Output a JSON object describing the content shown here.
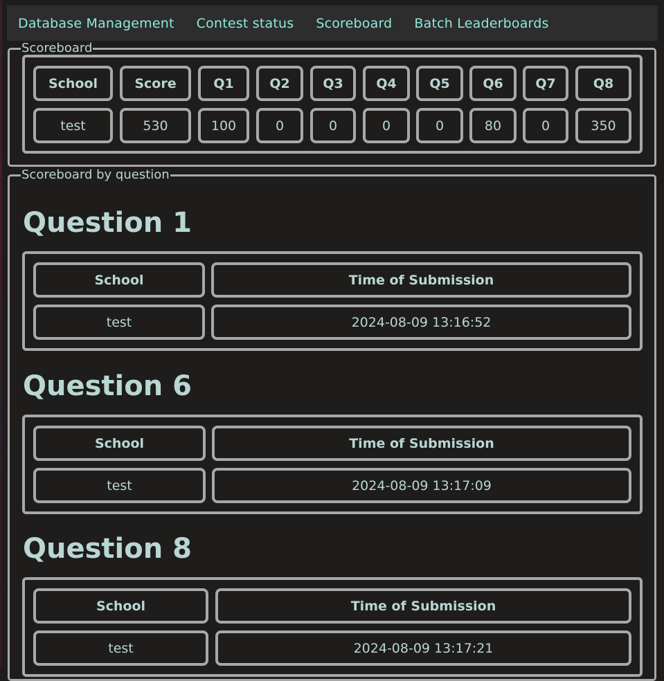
{
  "nav": {
    "items": [
      "Database Management",
      "Contest status",
      "Scoreboard",
      "Batch Leaderboards"
    ]
  },
  "scoreboard": {
    "legend": "Scoreboard",
    "headers": [
      "School",
      "Score",
      "Q1",
      "Q2",
      "Q3",
      "Q4",
      "Q5",
      "Q6",
      "Q7",
      "Q8"
    ],
    "row": [
      "test",
      "530",
      "100",
      "0",
      "0",
      "0",
      "0",
      "80",
      "0",
      "350"
    ]
  },
  "by_question": {
    "legend": "Scoreboard by question",
    "sections": [
      {
        "title": "Question 1",
        "headers": [
          "School",
          "Time of Submission"
        ],
        "row": [
          "test",
          "2024-08-09 13:16:52"
        ]
      },
      {
        "title": "Question 6",
        "headers": [
          "School",
          "Time of Submission"
        ],
        "row": [
          "test",
          "2024-08-09 13:17:09"
        ]
      },
      {
        "title": "Question 8",
        "headers": [
          "School",
          "Time of Submission"
        ],
        "row": [
          "test",
          "2024-08-09 13:17:21"
        ]
      }
    ]
  },
  "colors": {
    "background": "#1e1d1c",
    "navbar": "#2d2d2d",
    "nav_link": "#8ee9da",
    "text": "#b9d6d2",
    "border": "#a8a8a8"
  }
}
